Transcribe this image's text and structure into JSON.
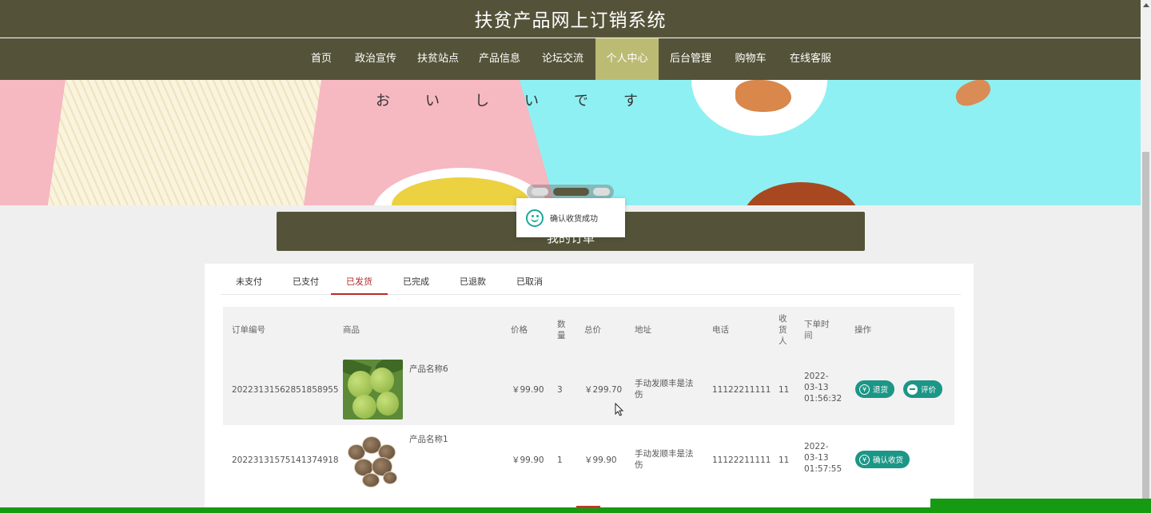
{
  "header": {
    "title": "扶贫产品网上订销系统"
  },
  "nav": {
    "items": [
      {
        "label": "首页"
      },
      {
        "label": "政治宣传"
      },
      {
        "label": "扶贫站点"
      },
      {
        "label": "产品信息"
      },
      {
        "label": "论坛交流"
      },
      {
        "label": "个人中心"
      },
      {
        "label": "后台管理"
      },
      {
        "label": "购物车"
      },
      {
        "label": "在线客服"
      }
    ],
    "active": "个人中心"
  },
  "banner": {
    "kana": [
      "お",
      "い",
      "し",
      "い",
      "で",
      "す"
    ],
    "carousel": {
      "count": 3,
      "active_index": 1
    }
  },
  "toast": {
    "message": "确认收货成功",
    "icon": "smile-icon"
  },
  "section": {
    "title": "我的订单"
  },
  "tabs": {
    "items": [
      "未支付",
      "已支付",
      "已发货",
      "已完成",
      "已退款",
      "已取消"
    ],
    "active": "已发货"
  },
  "table": {
    "headers": {
      "order_no": "订单编号",
      "product": "商品",
      "price": "价格",
      "qty": "数量",
      "total": "总价",
      "address": "地址",
      "phone": "电话",
      "receiver": "收货人",
      "order_time": "下单时间",
      "actions": "操作"
    },
    "rows": [
      {
        "order_no": "20223131562851858955",
        "product_name": "产品名称6",
        "image": "lime-fruit-photo",
        "price": "￥99.90",
        "qty": "3",
        "total": "￥299.70",
        "address": "手动发顺丰是法伤",
        "phone": "11122211111",
        "receiver": "11",
        "order_time": "2022-03-13 01:56:32",
        "actions": [
          {
            "label": "退货",
            "icon": "yen-icon"
          },
          {
            "label": "评价",
            "icon": "comment-icon"
          }
        ]
      },
      {
        "order_no": "20223131575141374918",
        "product_name": "产品名称1",
        "image": "mushroom-photo",
        "price": "￥99.90",
        "qty": "1",
        "total": "￥99.90",
        "address": "手动发顺丰是法伤",
        "phone": "11122211111",
        "receiver": "11",
        "order_time": "2022-03-13 01:57:55",
        "actions": [
          {
            "label": "确认收货",
            "icon": "yen-icon"
          }
        ]
      }
    ]
  },
  "colors": {
    "header_bg": "#545339",
    "nav_active": "#bcbb74",
    "tab_active": "#b52b2b",
    "button": "#1c9686",
    "bottom_bar": "#159a12"
  }
}
